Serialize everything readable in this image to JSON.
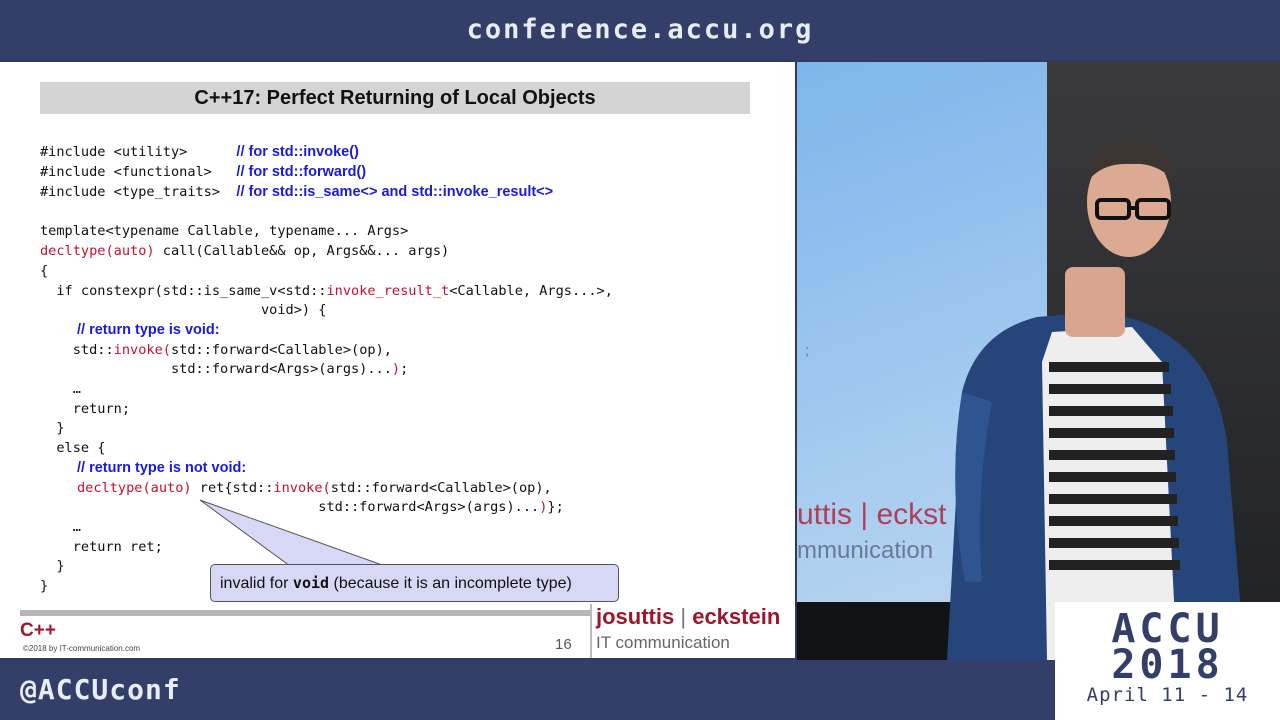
{
  "header": {
    "url": "conference.accu.org"
  },
  "footer": {
    "handle": "@ACCUconf"
  },
  "slide": {
    "title": "C++17: Perfect Returning of Local Objects",
    "code": {
      "l1": {
        "code": "#include <utility>      ",
        "comment": "// for std::invoke()"
      },
      "l2": {
        "code": "#include <functional>   ",
        "comment": "// for std::forward()"
      },
      "l3": {
        "code": "#include <type_traits>  ",
        "comment": "// for std::is_same<> and std::invoke_result<>"
      },
      "l5": "template<typename Callable, typename... Args>",
      "l6": {
        "kw": "decltype(auto)",
        "rest": " call(Callable&& op, Args&&... args)"
      },
      "l7": "{",
      "l8": {
        "a": "  if constexpr(std::is_same_v<std::",
        "kw": "invoke_result_t",
        "b": "<Callable, Args...>,"
      },
      "l9": "                           void>) {",
      "l10": {
        "comment": "// return type is void:"
      },
      "l11": {
        "a": "    std::",
        "kw": "invoke(",
        "b": "std::forward<Callable>(op),"
      },
      "l12": {
        "a": "                std::forward<Args>(args)...",
        "kw": ")",
        "b": ";"
      },
      "l13": "    …",
      "l14": "    return;",
      "l15": "  }",
      "l16": "  else {",
      "l17": {
        "comment": "// return type is not void:"
      },
      "l18": {
        "kw1": "decltype(auto)",
        "a": " ret{std::",
        "kw2": "invoke(",
        "b": "std::forward<Callable>(op),"
      },
      "l19": {
        "a": "                                  std::forward<Args>(args)...",
        "kw": ")",
        "b": "};"
      },
      "l20": "    …",
      "l21": "    return ret;",
      "l22": "  }",
      "l23": "}"
    },
    "callout": {
      "pre": "invalid for ",
      "mono": "void",
      "post": " (because it is an incomplete type)"
    },
    "footer": {
      "lang": "C++",
      "copyright": "©2018 by IT-communication.com",
      "page": "16",
      "brand_left": "josuttis",
      "brand_sep": "|",
      "brand_right": "eckstein",
      "brand_sub": "IT communication"
    }
  },
  "video": {
    "screen_text_1": "uttis | eckst",
    "screen_text_2": "mmunication",
    "screen_glyph": ";"
  },
  "logo": {
    "name": "ACCU",
    "year": "2018",
    "dates": "April 11 - 14"
  },
  "colors": {
    "banner": "#333f68",
    "keyword": "#c8102e",
    "comment": "#1a1adf",
    "brand": "#a0152c"
  }
}
